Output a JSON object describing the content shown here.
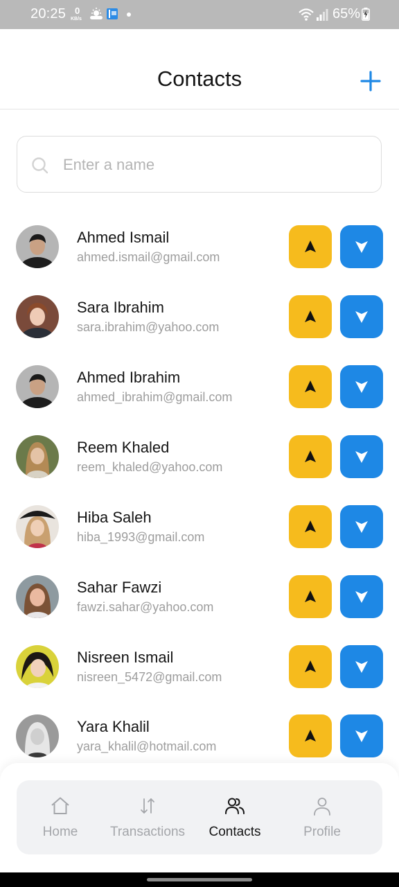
{
  "status_bar": {
    "time": "20:25",
    "net_speed_value": "0",
    "net_speed_unit": "KB/s",
    "battery": "65%"
  },
  "header": {
    "title": "Contacts",
    "add_icon": "plus-icon"
  },
  "search": {
    "placeholder": "Enter a name",
    "value": "",
    "icon": "search-icon"
  },
  "contacts": [
    {
      "name": "Ahmed Ismail",
      "email": "ahmed.ismail@gmail.com"
    },
    {
      "name": "Sara Ibrahim",
      "email": "sara.ibrahim@yahoo.com"
    },
    {
      "name": "Ahmed Ibrahim",
      "email": "ahmed_ibrahim@gmail.com"
    },
    {
      "name": "Reem Khaled",
      "email": "reem_khaled@yahoo.com"
    },
    {
      "name": "Hiba Saleh",
      "email": "hiba_1993@gmail.com"
    },
    {
      "name": "Sahar Fawzi",
      "email": "fawzi.sahar@yahoo.com"
    },
    {
      "name": "Nisreen Ismail",
      "email": "nisreen_5472@gmail.com"
    },
    {
      "name": "Yara Khalil",
      "email": "yara_khalil@hotmail.com"
    }
  ],
  "actions": {
    "send_icon": "arrow-up-icon",
    "request_icon": "arrow-down-icon",
    "send_color": "#f6bb1d",
    "request_color": "#1e88e5"
  },
  "nav": {
    "items": [
      {
        "label": "Home",
        "icon": "home-icon"
      },
      {
        "label": "Transactions",
        "icon": "transactions-icon"
      },
      {
        "label": "Contacts",
        "icon": "contacts-icon"
      },
      {
        "label": "Profile",
        "icon": "profile-icon"
      }
    ],
    "active": "Contacts"
  },
  "colors": {
    "accent": "#1e88e5",
    "yellow": "#f6bb1d",
    "status_bar": "#b9b9b9"
  }
}
